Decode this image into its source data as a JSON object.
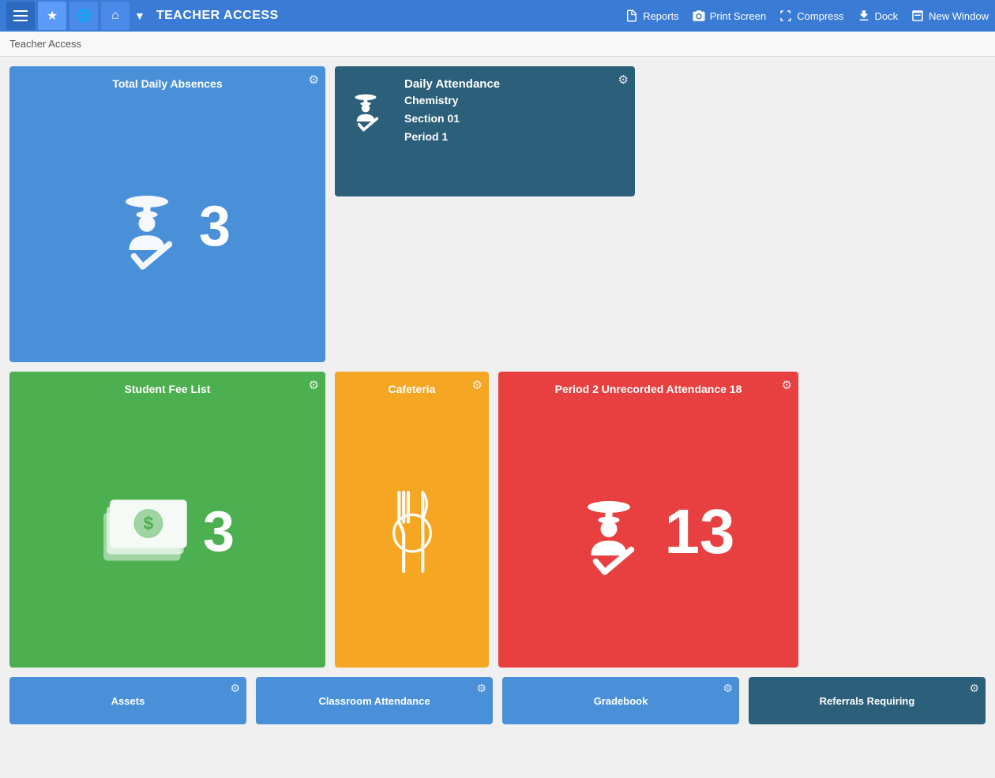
{
  "header": {
    "title": "TEACHER ACCESS",
    "nav_buttons": [
      "star",
      "globe",
      "home"
    ],
    "actions": [
      {
        "label": "Reports",
        "icon": "document-icon"
      },
      {
        "label": "Print Screen",
        "icon": "camera-icon"
      },
      {
        "label": "Compress",
        "icon": "compress-icon"
      },
      {
        "label": "Dock",
        "icon": "dock-icon"
      },
      {
        "label": "New Window",
        "icon": "window-icon"
      }
    ]
  },
  "breadcrumb": "Teacher Access",
  "tiles": {
    "total_daily_absences": {
      "title": "Total Daily Absences",
      "count": "3"
    },
    "daily_attendance": {
      "title": "Daily Attendance",
      "class_name": "Chemistry",
      "section": "Section 01",
      "period": "Period 1"
    },
    "student_fee_list": {
      "title": "Student Fee List",
      "count": "3"
    },
    "cafeteria": {
      "title": "Cafeteria"
    },
    "period2": {
      "title": "Period 2 Unrecorded Attendance 18",
      "count": "13"
    }
  },
  "bottom_tiles": [
    {
      "label": "Assets",
      "type": "blue"
    },
    {
      "label": "Classroom Attendance",
      "type": "blue"
    },
    {
      "label": "Gradebook",
      "type": "blue"
    },
    {
      "label": "Referrals Requiring",
      "type": "teal"
    }
  ]
}
